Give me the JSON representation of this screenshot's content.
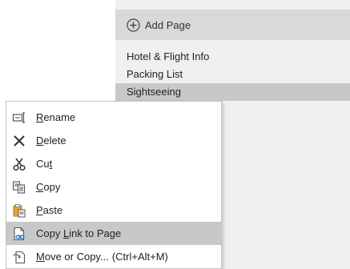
{
  "add_page": {
    "label": "Add Page",
    "icon": "plus-circle-icon"
  },
  "pages": [
    {
      "label": "Hotel & Flight Info",
      "selected": false
    },
    {
      "label": "Packing List",
      "selected": false
    },
    {
      "label": "Sightseeing",
      "selected": true
    }
  ],
  "context_menu": {
    "items": [
      {
        "label": "Rename",
        "accel_index": 0,
        "icon": "rename-icon",
        "shortcut": "",
        "highlighted": false
      },
      {
        "label": "Delete",
        "accel_index": 0,
        "icon": "delete-icon",
        "shortcut": "",
        "highlighted": false
      },
      {
        "label": "Cut",
        "accel_index": 2,
        "icon": "scissors-icon",
        "shortcut": "",
        "highlighted": false
      },
      {
        "label": "Copy",
        "accel_index": 0,
        "icon": "copy-icon",
        "shortcut": "",
        "highlighted": false
      },
      {
        "label": "Paste",
        "accel_index": 0,
        "icon": "paste-icon",
        "shortcut": "",
        "highlighted": false
      },
      {
        "label": "Copy Link to Page",
        "accel_index": 5,
        "icon": "link-page-icon",
        "shortcut": "",
        "highlighted": true
      },
      {
        "label": "Move or Copy...",
        "accel_index": 0,
        "icon": "move-copy-icon",
        "shortcut": "(Ctrl+Alt+M)",
        "highlighted": false
      }
    ]
  },
  "colors": {
    "pane_bg": "#f0f0f0",
    "selected_bg": "#c8c8c8",
    "accent_blue": "#2b79c2",
    "paste_orange": "#e6a53a"
  }
}
